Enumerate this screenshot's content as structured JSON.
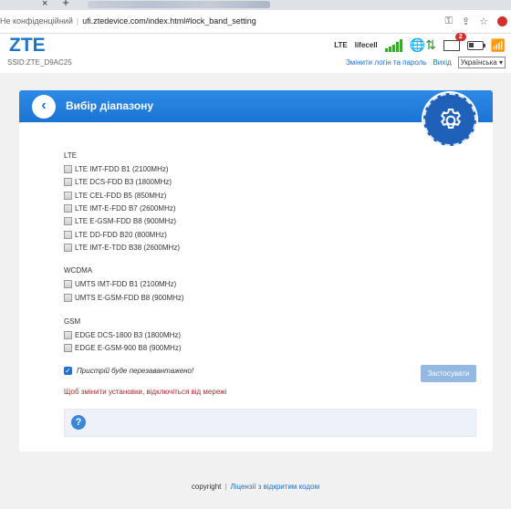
{
  "browser": {
    "close_glyph": "×",
    "new_tab_glyph": "+",
    "security_text": "Не конфіденційний",
    "url": "ufi.ztedevice.com/index.html#lock_band_setting",
    "icons": [
      "key-icon",
      "share-icon",
      "star-icon",
      "opera-icon"
    ]
  },
  "header": {
    "logo": "ZTE",
    "ssid": "SSID:ZTE_D9AC25",
    "network_type": "LTE",
    "operator": "lifecell",
    "message_count": "2",
    "change_login_link": "Змінити логін та пароль",
    "logout_link": "Вихід",
    "language": "Українська ▾",
    "signal_color": "#3da830"
  },
  "card": {
    "back_glyph": "‹",
    "title": "Вибір діапазону",
    "header_color": "#1b74d3"
  },
  "sections": {
    "lte": {
      "title": "LTE",
      "bands": [
        "LTE IMT-FDD B1 (2100MHz)",
        "LTE DCS-FDD B3 (1800MHz)",
        "LTE CEL-FDD B5 (850MHz)",
        "LTE IMT-E-FDD B7 (2600MHz)",
        "LTE E-GSM-FDD B8 (900MHz)",
        "LTE DD-FDD B20 (800MHz)",
        "LTE IMT-E-TDD B38 (2600MHz)"
      ]
    },
    "wcdma": {
      "title": "WCDMA",
      "bands": [
        "UMTS IMT-FDD B1 (2100MHz)",
        "UMTS E-GSM-FDD B8 (900MHz)"
      ]
    },
    "gsm": {
      "title": "GSM",
      "bands": [
        "EDGE DCS-1800 B3 (1800MHz)",
        "EDGE E-GSM-900 B8 (900MHz)"
      ]
    }
  },
  "form": {
    "reboot_label": "Пристрій буде перезавантажено!",
    "check_glyph": "✓",
    "apply_button": "Застосувати",
    "warning": "Щоб змінити установки, відключіться від мережі",
    "help_glyph": "?"
  },
  "footer": {
    "copyright": "copyright",
    "separator": "|",
    "license_link": "Ліцензії з відкритим кодом"
  }
}
